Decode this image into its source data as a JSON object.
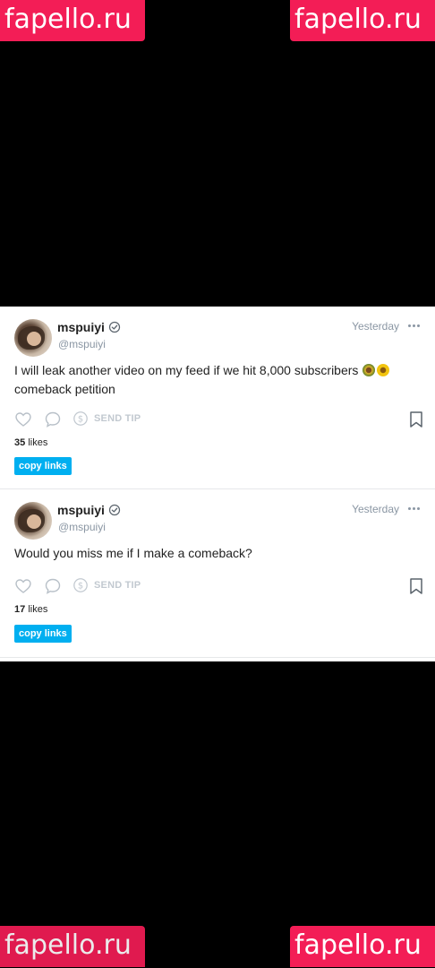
{
  "watermark": {
    "text": "fapello.ru",
    "color": "#f31d56"
  },
  "posts": [
    {
      "username": "mspuiyi",
      "handle": "@mspuiyi",
      "time": "Yesterday",
      "text": "I will leak another video on my feed if we hit 8,000 subscribers",
      "text_after_emoji": "comeback petition",
      "emojis": [
        "sunflower-pot",
        "sunflower"
      ],
      "send_tip": "SEND TIP",
      "likes_count": "35",
      "likes_label": "likes",
      "copy_links": "copy links"
    },
    {
      "username": "mspuiyi",
      "handle": "@mspuiyi",
      "time": "Yesterday",
      "text": "Would you miss me if I make a comeback?",
      "send_tip": "SEND TIP",
      "likes_count": "17",
      "likes_label": "likes",
      "copy_links": "copy links"
    }
  ],
  "colors": {
    "accent": "#00aff0",
    "muted": "#8a96a3",
    "background": "#000000"
  }
}
